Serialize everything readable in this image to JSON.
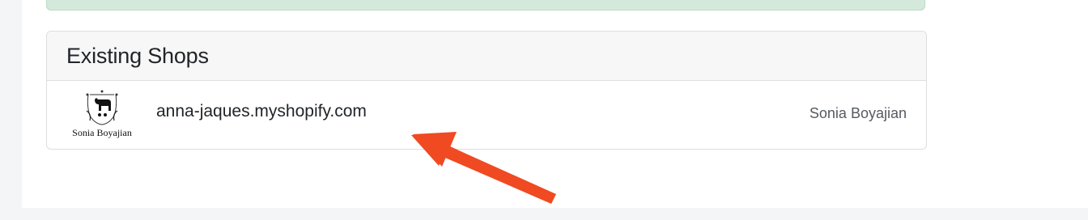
{
  "existing_shops": {
    "title": "Existing Shops",
    "shops": [
      {
        "logo_text": "Sonia Boyajian",
        "domain": "anna-jaques.myshopify.com",
        "owner": "Sonia Boyajian"
      }
    ]
  },
  "colors": {
    "alert_background": "#d4e9dc",
    "card_header_background": "#f7f7f7",
    "annotation_arrow": "#f04a23"
  },
  "icons": {
    "shop_logo": "shop-crest-icon",
    "annotation": "red-arrow-icon"
  }
}
